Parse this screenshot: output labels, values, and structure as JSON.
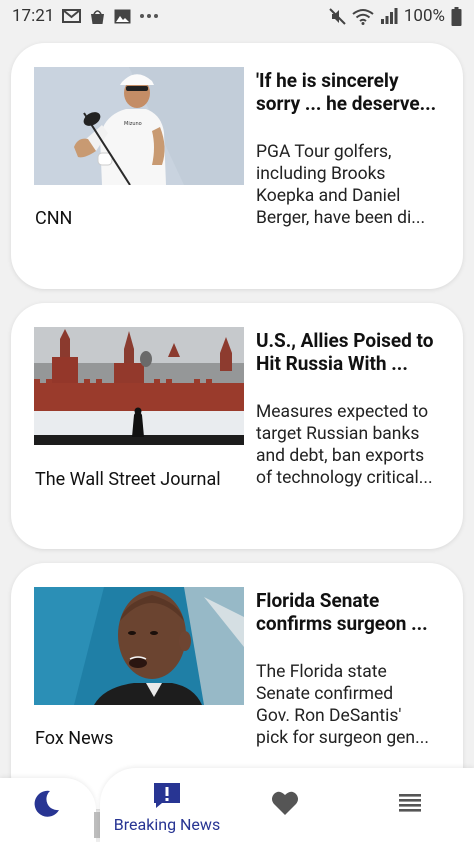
{
  "status_bar": {
    "time": "17:21",
    "left_icons": [
      "gmail-icon",
      "shopping-bag-icon",
      "image-icon",
      "more-icon"
    ],
    "right_icons": [
      "mute-icon",
      "wifi-icon",
      "signal-icon"
    ],
    "battery": "100%"
  },
  "articles": [
    {
      "title": "'If he is sincerely sorry ... he deserve...",
      "description_lines": [
        "PGA Tour golfers,",
        "including Brooks",
        "Koepka and Daniel",
        "Berger, have been di..."
      ],
      "source": "CNN",
      "image": "golfer-photo"
    },
    {
      "title": "U.S., Allies Poised to Hit Russia With ...",
      "description_lines": [
        "Measures expected to",
        "target Russian banks",
        "and debt, ban exports",
        "of technology critical..."
      ],
      "source": "The Wall Street Journal",
      "image": "kremlin-photo"
    },
    {
      "title": "Florida Senate confirms surgeon ...",
      "description_lines": [
        "The Florida state",
        "Senate confirmed",
        "Gov. Ron DeSantis'",
        "pick for surgeon gen..."
      ],
      "source": "Fox News",
      "image": "man-speaking-photo"
    }
  ],
  "nav": {
    "items": [
      {
        "icon": "moon-icon",
        "label": ""
      },
      {
        "icon": "breaking-news-icon",
        "label": "Breaking News"
      },
      {
        "icon": "heart-icon",
        "label": ""
      },
      {
        "icon": "menu-icon",
        "label": ""
      }
    ],
    "accent": "#283593",
    "inactive": "#555555"
  }
}
